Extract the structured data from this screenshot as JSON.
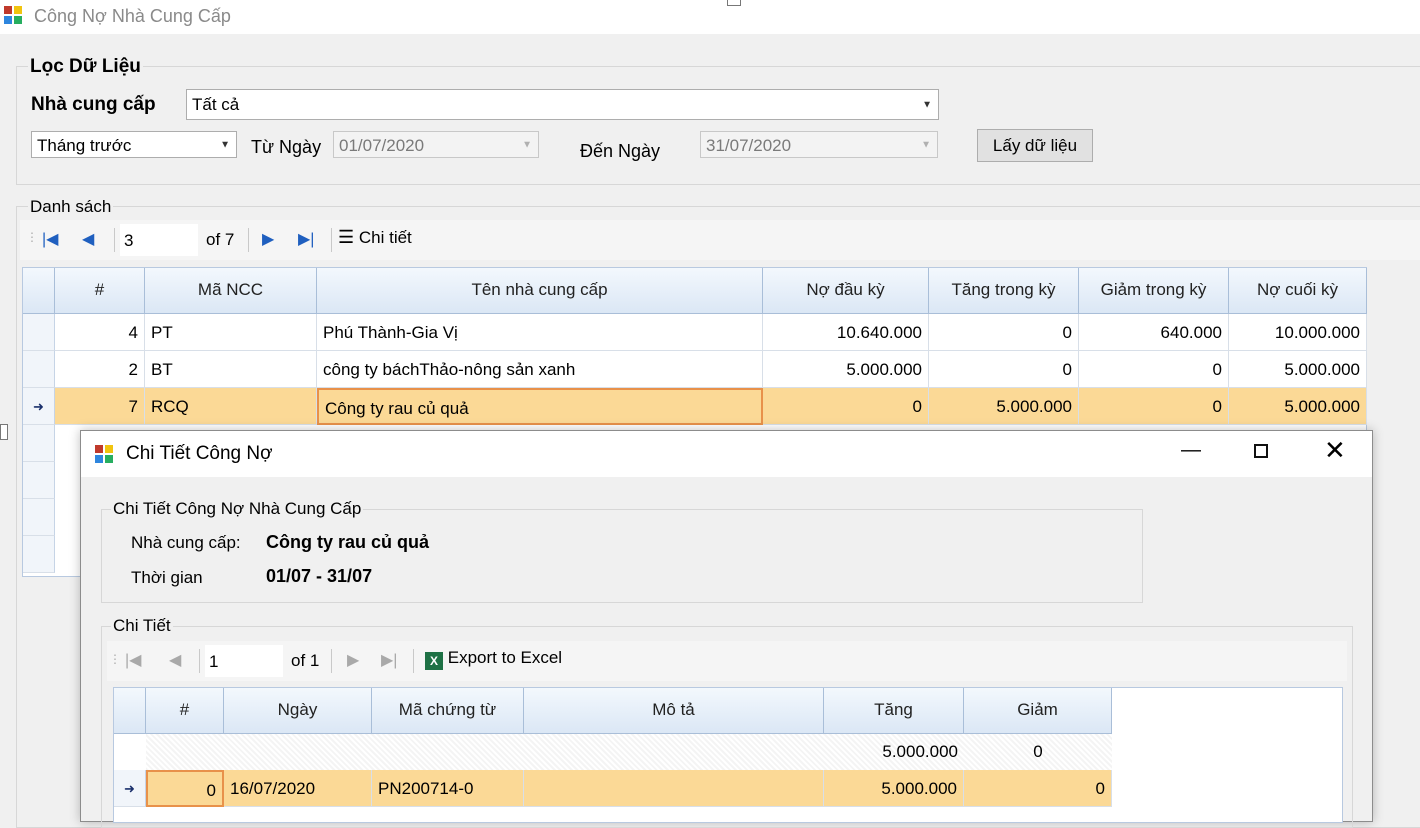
{
  "main_window": {
    "title": "Công Nợ Nhà Cung Cấp"
  },
  "filter": {
    "legend": "Lọc Dữ Liệu",
    "supplier_label": "Nhà cung cấp",
    "supplier_value": "Tất cả",
    "period_value": "Tháng trước",
    "from_label": "Từ Ngày",
    "from_value": "01/07/2020",
    "to_label": "Đến Ngày",
    "to_value": "31/07/2020",
    "fetch_button": "Lấy dữ liệu"
  },
  "list": {
    "legend": "Danh sách",
    "pager": {
      "current": "3",
      "of_text": "of 7",
      "detail_label": "Chi tiết"
    },
    "columns": [
      "#",
      "Mã NCC",
      "Tên nhà cung cấp",
      "Nợ đầu kỳ",
      "Tăng trong kỳ",
      "Giảm trong kỳ",
      "Nợ cuối kỳ"
    ],
    "rows": [
      {
        "no": "4",
        "code": "PT",
        "name": "Phú Thành-Gia Vị",
        "open": "10.640.000",
        "inc": "0",
        "dec": "640.000",
        "close": "10.000.000"
      },
      {
        "no": "2",
        "code": "BT",
        "name": "công ty báchThảo-nông sản xanh",
        "open": "5.000.000",
        "inc": "0",
        "dec": "0",
        "close": "5.000.000"
      },
      {
        "no": "7",
        "code": "RCQ",
        "name": "Công ty rau củ quả",
        "open": "0",
        "inc": "5.000.000",
        "dec": "0",
        "close": "5.000.000"
      }
    ],
    "current_row_marker": "➜"
  },
  "dialog": {
    "title": "Chi Tiết Công Nợ",
    "info_legend": "Chi Tiết Công Nợ Nhà Cung Cấp",
    "supplier_label": "Nhà cung cấp:",
    "supplier_value": "Công ty rau củ quả",
    "time_label": "Thời gian",
    "time_value": "01/07 - 31/07",
    "detail_legend": "Chi Tiết",
    "pager": {
      "current": "1",
      "of_text": "of 1",
      "export_label": "Export to Excel"
    },
    "columns": [
      "#",
      "Ngày",
      "Mã chứng từ",
      "Mô tả",
      "Tăng",
      "Giảm"
    ],
    "totals": {
      "inc": "5.000.000",
      "dec": "0"
    },
    "rows": [
      {
        "no": "0",
        "date": "16/07/2020",
        "voucher": "PN200714-0",
        "desc": "",
        "inc": "5.000.000",
        "dec": "0"
      }
    ]
  },
  "colors": {
    "selected_row": "#fbd996",
    "selected_cell_border": "#e8914a",
    "nav_blue": "#1f5fbf"
  }
}
